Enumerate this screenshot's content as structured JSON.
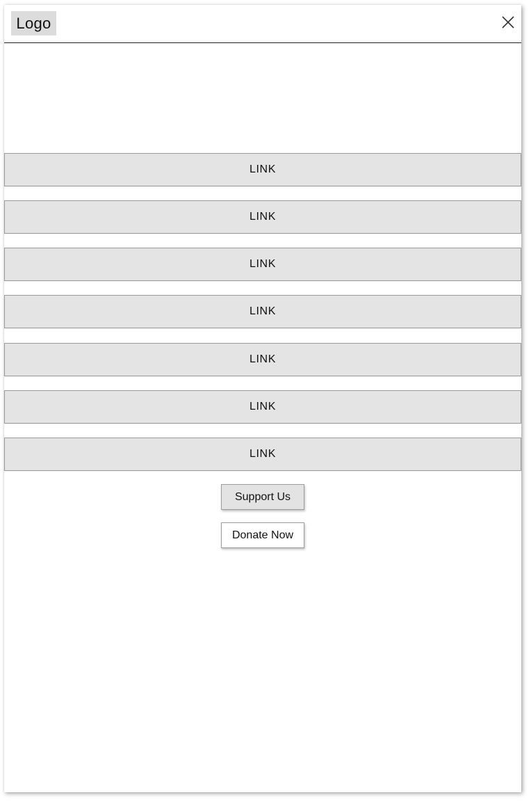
{
  "header": {
    "logo_text": "Logo",
    "close_icon": "close-icon"
  },
  "nav": {
    "links": [
      {
        "label": "LINK"
      },
      {
        "label": "LINK"
      },
      {
        "label": "LINK"
      },
      {
        "label": "LINK"
      },
      {
        "label": "LINK"
      },
      {
        "label": "LINK"
      },
      {
        "label": "LINK"
      }
    ]
  },
  "actions": {
    "support_label": "Support Us",
    "donate_label": "Donate Now"
  },
  "colors": {
    "link_background": "#e4e4e4",
    "logo_background": "#dcdcdc",
    "support_background": "#e3e3e3",
    "donate_background": "#ffffff"
  }
}
